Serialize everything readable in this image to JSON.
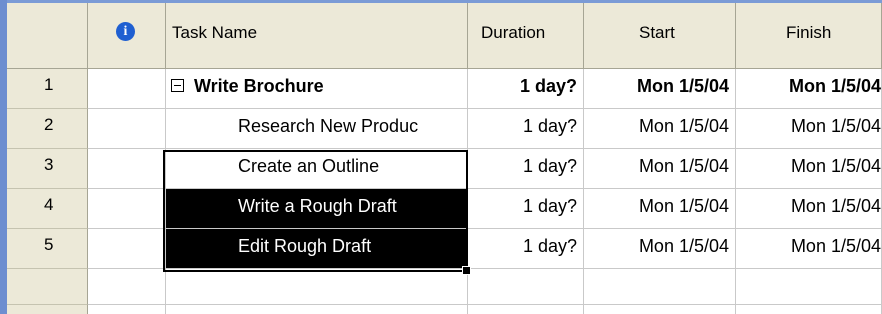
{
  "columns": {
    "indicator_icon": "info-icon",
    "task_name": "Task Name",
    "duration": "Duration",
    "start": "Start",
    "finish": "Finish"
  },
  "rows": [
    {
      "id": "1",
      "name": "Write Brochure",
      "duration": "1 day?",
      "start": "Mon 1/5/04",
      "finish": "Mon 1/5/04",
      "summary": true
    },
    {
      "id": "2",
      "name": "Research New Produc",
      "duration": "1 day?",
      "start": "Mon 1/5/04",
      "finish": "Mon 1/5/04"
    },
    {
      "id": "3",
      "name": "Create an Outline",
      "duration": "1 day?",
      "start": "Mon 1/5/04",
      "finish": "Mon 1/5/04",
      "active": true
    },
    {
      "id": "4",
      "name": "Write a Rough Draft",
      "duration": "1 day?",
      "start": "Mon 1/5/04",
      "finish": "Mon 1/5/04",
      "selected": true
    },
    {
      "id": "5",
      "name": "Edit Rough Draft",
      "duration": "1 day?",
      "start": "Mon 1/5/04",
      "finish": "Mon 1/5/04",
      "selected": true
    }
  ],
  "colors": {
    "header_bg": "#ece9d8",
    "selection_bg": "#000000",
    "info_icon": "#1f5fd1",
    "left_bar": "#6d8ed0"
  }
}
